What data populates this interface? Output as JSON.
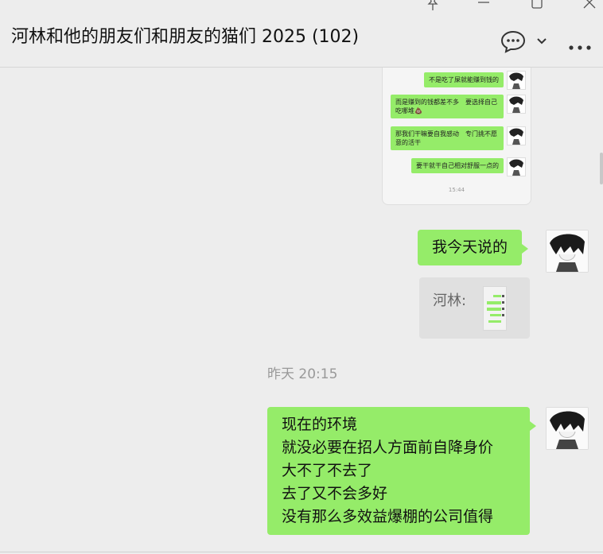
{
  "window": {
    "title": "河林和他的朋友们和朋友的猫们 2025 (102)",
    "controls": [
      "pin-icon",
      "minimize-icon",
      "maximize-icon",
      "close-icon"
    ]
  },
  "header": {
    "icons": [
      "chat-bubble-icon",
      "chevron-down-icon",
      "more-icon"
    ]
  },
  "quoted_screenshot": {
    "messages": [
      "不是吃了屎就能赚到钱的",
      "而是赚到的钱都差不多　要选择自己吃哪堆💩",
      "那我们干嘛要自我感动　专门挑不愿意的活干",
      "要干就干自己相对舒服一点的"
    ],
    "time": "15:44"
  },
  "messages": [
    {
      "type": "text",
      "side": "right",
      "lines": [
        "我今天说的"
      ]
    },
    {
      "type": "quote",
      "side": "right",
      "label": "河林:"
    },
    {
      "type": "time",
      "text": "昨天 20:15"
    },
    {
      "type": "text",
      "side": "right",
      "lines": [
        "现在的环境",
        "就没必要在招人方面前自降身价",
        "大不了不去了",
        "去了又不会多好",
        "没有那么多效益爆棚的公司值得"
      ]
    }
  ],
  "colors": {
    "bubble_green": "#95ec69",
    "background": "#ededed"
  }
}
